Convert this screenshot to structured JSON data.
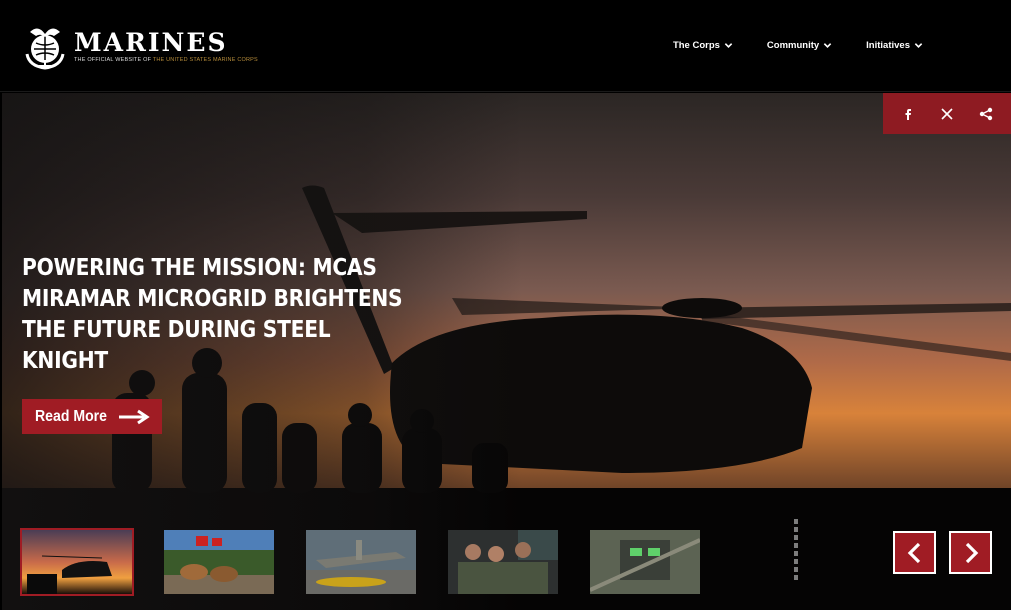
{
  "header": {
    "logo_word": "MARINES",
    "logo_tag_prefix": "THE OFFICIAL WEBSITE OF",
    "logo_tag_highlight": "THE UNITED STATES MARINE CORPS",
    "nav": [
      {
        "label": "The Corps",
        "icon": "chevron-down-icon"
      },
      {
        "label": "Community",
        "icon": "chevron-down-icon"
      },
      {
        "label": "Initiatives",
        "icon": "chevron-down-icon"
      }
    ]
  },
  "share": {
    "icons": [
      "facebook-icon",
      "x-icon",
      "share-icon"
    ]
  },
  "hero": {
    "headline": "POWERING THE MISSION: MCAS MIRAMAR MICROGRID BRIGHTENS THE FUTURE DURING STEEL KNIGHT",
    "cta_label": "Read More",
    "cta_icon": "arrow-right-icon"
  },
  "carousel": {
    "active_index": 0,
    "thumbnails": 5,
    "prev_icon": "chevron-left-icon",
    "next_icon": "chevron-right-icon"
  },
  "colors": {
    "accent_red": "#a01c24",
    "share_red": "#8e1b22",
    "gold": "#b58b3a"
  }
}
